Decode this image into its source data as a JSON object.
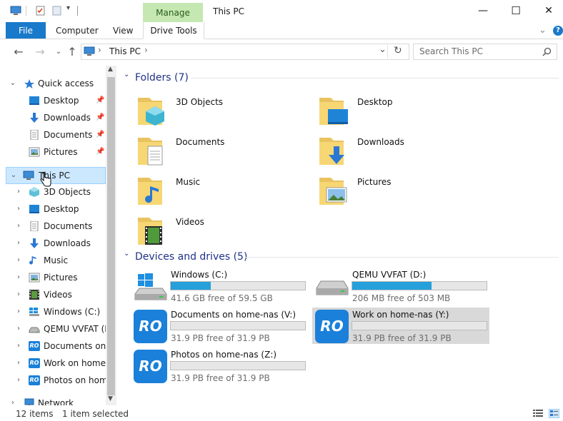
{
  "window": {
    "title": "This PC",
    "context_tab": "Manage",
    "minimize": "—",
    "maximize": "☐",
    "close": "✕"
  },
  "ribbon": {
    "file": "File",
    "computer": "Computer",
    "view": "View",
    "drive_tools": "Drive Tools",
    "expand": "⌄",
    "help": "?"
  },
  "address": {
    "path": "This PC",
    "separator": "›",
    "dropdown": "⌄",
    "refresh": "↻",
    "search_placeholder": "Search This PC"
  },
  "nav": {
    "quick_access": "Quick access",
    "quick_items": [
      {
        "label": "Desktop"
      },
      {
        "label": "Downloads"
      },
      {
        "label": "Documents"
      },
      {
        "label": "Pictures"
      }
    ],
    "this_pc": "This PC",
    "pc_items": [
      {
        "label": "3D Objects"
      },
      {
        "label": "Desktop"
      },
      {
        "label": "Documents"
      },
      {
        "label": "Downloads"
      },
      {
        "label": "Music"
      },
      {
        "label": "Pictures"
      },
      {
        "label": "Videos"
      },
      {
        "label": "Windows (C:)"
      },
      {
        "label": "QEMU VVFAT (D:)"
      },
      {
        "label": "Documents on home-nas (V:)"
      },
      {
        "label": "Work on home-nas (Y:)"
      },
      {
        "label": "Photos on home-nas (Z:)"
      }
    ],
    "network": "Network"
  },
  "content": {
    "folders_header": "Folders (7)",
    "folders": [
      {
        "name": "3D Objects"
      },
      {
        "name": "Desktop"
      },
      {
        "name": "Documents"
      },
      {
        "name": "Downloads"
      },
      {
        "name": "Music"
      },
      {
        "name": "Pictures"
      },
      {
        "name": "Videos"
      }
    ],
    "drives_header": "Devices and drives (5)",
    "drives": [
      {
        "name": "Windows (C:)",
        "free": "41.6 GB free of 59.5 GB",
        "used_fraction": 0.3
      },
      {
        "name": "QEMU VVFAT (D:)",
        "free": "206 MB free of 503 MB",
        "used_fraction": 0.59
      },
      {
        "name": "Documents on home-nas (V:)",
        "free": "31.9 PB free of 31.9 PB",
        "used_fraction": 0.0
      },
      {
        "name": "Work on home-nas (Y:)",
        "free": "31.9 PB free of 31.9 PB",
        "used_fraction": 0.0
      },
      {
        "name": "Photos on home-nas (Z:)",
        "free": "31.9 PB free of 31.9 PB",
        "used_fraction": 0.0
      }
    ],
    "nas_badge": "RO"
  },
  "status": {
    "items": "12 items",
    "selected": "1 item selected"
  },
  "colors": {
    "accent": "#1979ca",
    "manage_tab": "#c5e8b2",
    "drive_fill": "#26a0da",
    "selection": "#cce8ff",
    "header_text": "#1e3287"
  }
}
